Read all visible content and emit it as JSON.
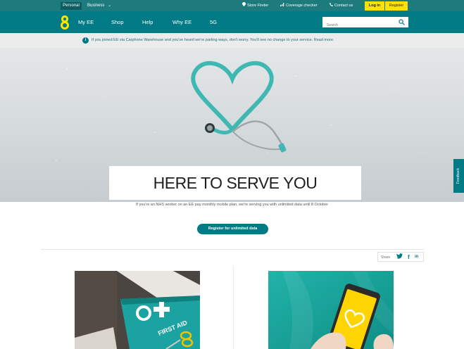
{
  "topbar": {
    "personal": "Personal",
    "business": "Business",
    "business_chevron": "⌄",
    "store_finder": "Store Finder",
    "coverage_checker": "Coverage checker",
    "contact_us": "Contact us",
    "log_in": "Log in",
    "register": "Register"
  },
  "nav": {
    "logo_text": "8",
    "items": [
      "My EE",
      "Shop",
      "Help",
      "Why EE",
      "5G"
    ],
    "search_placeholder": "Search"
  },
  "notice": {
    "icon_text": "i",
    "text": "If you joined EE via Carphone Warehouse and you've heard we're parting ways, don't worry. You'll see no change to your service. Read more."
  },
  "hero": {
    "headline": "HERE TO SERVE YOU",
    "subtext": "If you're an NHS worker on an EE pay monthly mobile plan, we're serving you with unlimited data until 8 October",
    "cta": "Register for unlimited data"
  },
  "share": {
    "label": "Share",
    "twitter": "🐦",
    "facebook": "f",
    "linkedin": "in"
  },
  "feedback": "Feedback",
  "cards": {
    "first_aid_text": "FIRST AID"
  },
  "colors": {
    "brand_teal": "#007b85",
    "topbar_teal": "#1d7b7e",
    "accent_yellow": "#ffe100"
  }
}
